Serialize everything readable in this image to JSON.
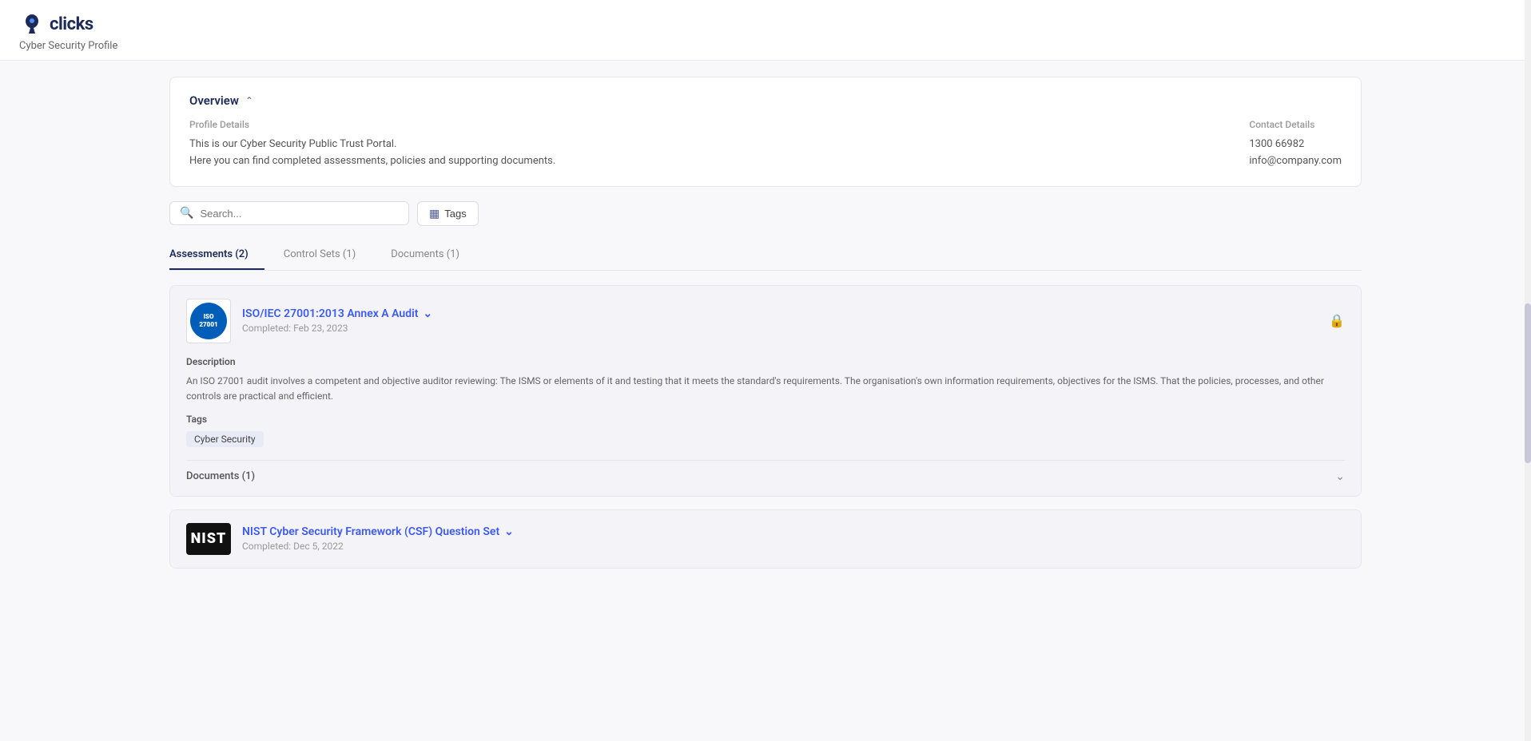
{
  "header": {
    "logo_text": "clicks",
    "page_subtitle": "Cyber Security Profile"
  },
  "overview": {
    "title": "Overview",
    "profile_label": "Profile Details",
    "profile_line1": "This is our Cyber Security Public Trust Portal.",
    "profile_line2": "Here you can find completed assessments, policies and supporting documents.",
    "contact_label": "Contact Details",
    "contact_phone": "1300 66982",
    "contact_email": "info@company.com"
  },
  "search": {
    "placeholder": "Search..."
  },
  "tags_button": {
    "label": "Tags"
  },
  "tabs": [
    {
      "label": "Assessments (2)",
      "id": "assessments",
      "active": true
    },
    {
      "label": "Control Sets (1)",
      "id": "control-sets",
      "active": false
    },
    {
      "label": "Documents (1)",
      "id": "documents",
      "active": false
    }
  ],
  "assessments": [
    {
      "id": "iso-27001",
      "logo_type": "iso",
      "logo_text": "ISO 27001",
      "title": "ISO/IEC 27001:2013 Annex A Audit",
      "completed": "Completed: Feb 23, 2023",
      "description_label": "Description",
      "description": "An ISO 27001 audit involves a competent and objective auditor reviewing: The ISMS or elements of it and testing that it meets the standard's requirements. The organisation's own information requirements, objectives for the ISMS. That the policies, processes, and other controls are practical and efficient.",
      "tags_label": "Tags",
      "tags": [
        "Cyber Security"
      ],
      "documents_label": "Documents (1)"
    },
    {
      "id": "nist-csf",
      "logo_type": "nist",
      "logo_text": "NIST",
      "title": "NIST Cyber Security Framework (CSF) Question Set",
      "completed": "Completed: Dec 5, 2022",
      "description_label": "",
      "description": "",
      "tags_label": "",
      "tags": [],
      "documents_label": ""
    }
  ]
}
